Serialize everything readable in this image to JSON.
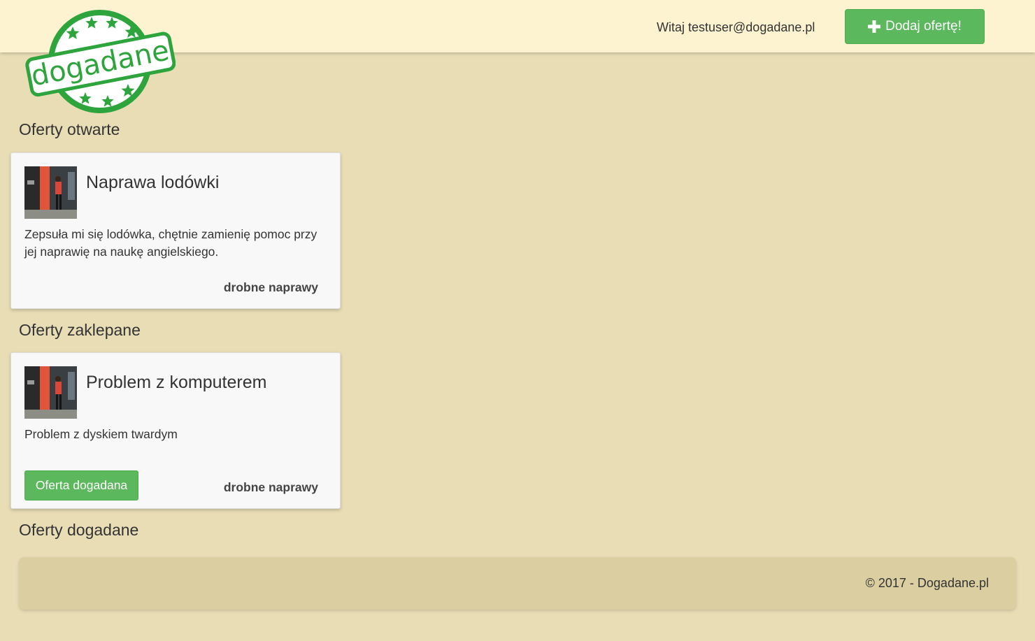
{
  "header": {
    "logo_text": "dogadane",
    "greeting": "Witaj testuser@dogadane.pl",
    "add_offer_label": "Dodaj ofertę!"
  },
  "sections": {
    "open": {
      "title": "Oferty otwarte",
      "offers": [
        {
          "title": "Naprawa lodówki",
          "description": "Zepsuła mi się lodówka, chętnie zamienię pomoc przy jej naprawię na naukę angielskiego.",
          "category": "drobne naprawy"
        }
      ]
    },
    "booked": {
      "title": "Oferty zaklepane",
      "offers": [
        {
          "title": "Problem z komputerem",
          "description": "Problem z dyskiem twardym",
          "category": "drobne naprawy",
          "action_label": "Oferta dogadana"
        }
      ]
    },
    "agreed": {
      "title": "Oferty dogadane",
      "offers": []
    }
  },
  "footer": {
    "copyright": "© 2017 - Dogadane.pl"
  },
  "colors": {
    "page_bg": "#e8ddb5",
    "header_bg": "#fdf3d0",
    "accent_green": "#5cb85c",
    "logo_green": "#2ea43c",
    "card_bg": "#f8f8f8",
    "footer_bg": "#dbcea0"
  }
}
